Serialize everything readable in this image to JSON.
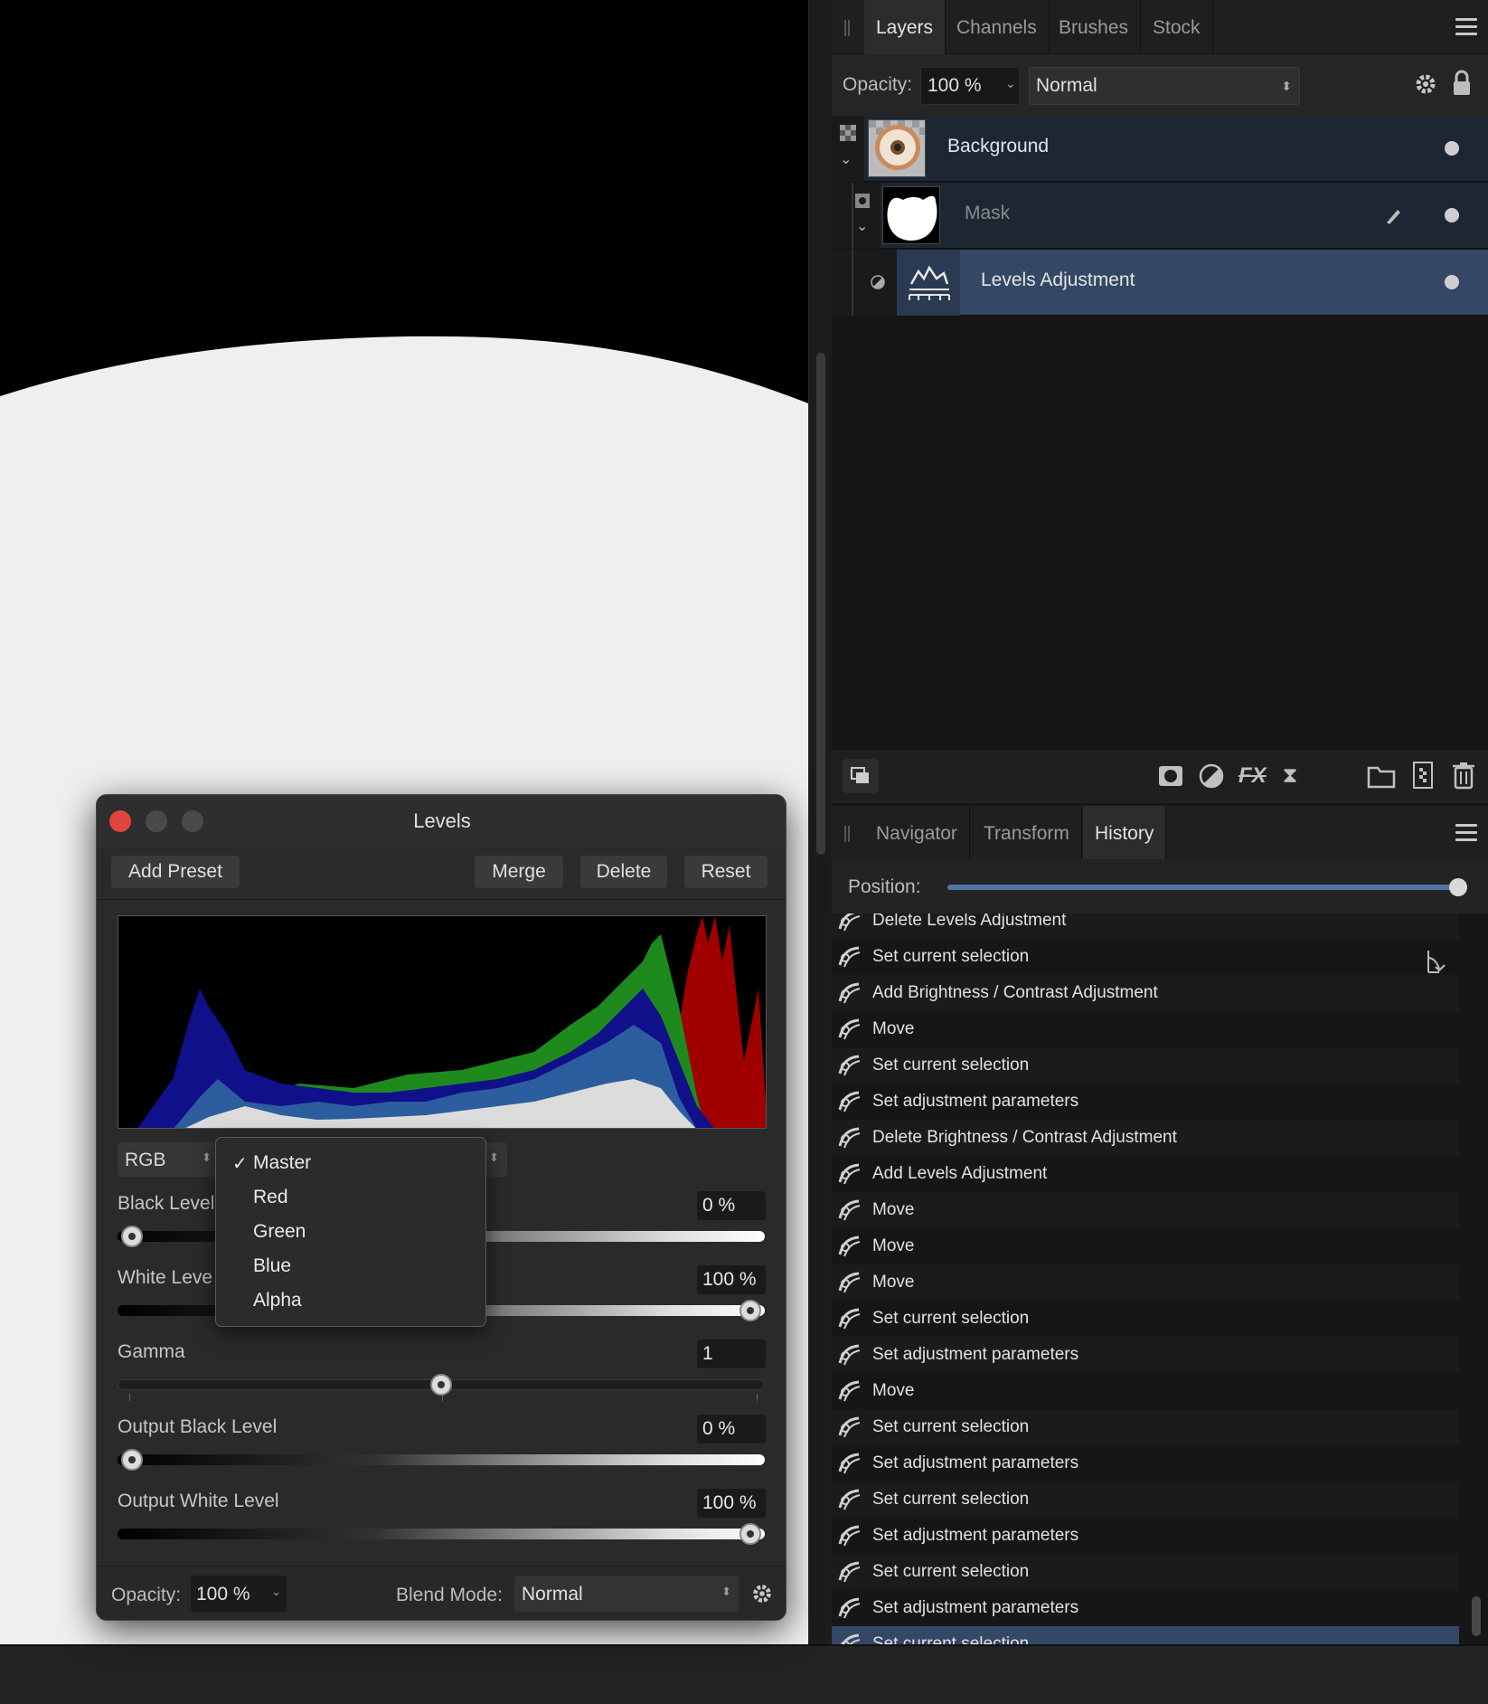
{
  "layers_panel": {
    "tabs": [
      "Layers",
      "Channels",
      "Brushes",
      "Stock"
    ],
    "active_tab": "Layers",
    "opacity_label": "Opacity:",
    "opacity_value": "100 %",
    "blend_mode": "Normal",
    "layers": [
      {
        "name": "Background",
        "thumb": "donut-image"
      },
      {
        "name": "Mask",
        "thumb": "mask-silhouette"
      },
      {
        "name": "Levels Adjustment",
        "thumb": "levels-icon",
        "selected": true
      }
    ]
  },
  "history_panel": {
    "tabs": [
      "Navigator",
      "Transform",
      "History"
    ],
    "active_tab": "History",
    "position_label": "Position:",
    "position_value": 1.0,
    "items": [
      "Delete Levels Adjustment",
      "Set current selection",
      "Add Brightness / Contrast Adjustment",
      "Move",
      "Set current selection",
      "Set adjustment parameters",
      "Delete Brightness / Contrast Adjustment",
      "Add Levels Adjustment",
      "Move",
      "Move",
      "Move",
      "Set current selection",
      "Set adjustment parameters",
      "Move",
      "Set current selection",
      "Set adjustment parameters",
      "Set current selection",
      "Set adjustment parameters",
      "Set current selection",
      "Set adjustment parameters",
      "Set current selection"
    ],
    "selected_index": 20
  },
  "levels_dialog": {
    "title": "Levels",
    "buttons": {
      "add_preset": "Add Preset",
      "merge": "Merge",
      "delete": "Delete",
      "reset": "Reset"
    },
    "channel_select": "RGB",
    "black_level": {
      "label": "Black Level",
      "value": "0 %",
      "fraction": 0.0
    },
    "white_level": {
      "label": "White Leve",
      "value": "100 %",
      "fraction": 1.0
    },
    "gamma": {
      "label": "Gamma",
      "value": "1",
      "fraction": 0.5
    },
    "output_black_level": {
      "label": "Output Black Level",
      "value": "0 %",
      "fraction": 0.0
    },
    "output_white_level": {
      "label": "Output White Level",
      "value": "100 %",
      "fraction": 1.0
    },
    "footer": {
      "opacity_label": "Opacity:",
      "opacity_value": "100 %",
      "blend_label": "Blend Mode:",
      "blend_value": "Normal"
    },
    "channel_menu": {
      "items": [
        "Master",
        "Red",
        "Green",
        "Blue",
        "Alpha"
      ],
      "checked": "Master"
    }
  },
  "colors": {
    "selection": "#344866",
    "accent": "#5176a6",
    "close": "#e0443e"
  }
}
